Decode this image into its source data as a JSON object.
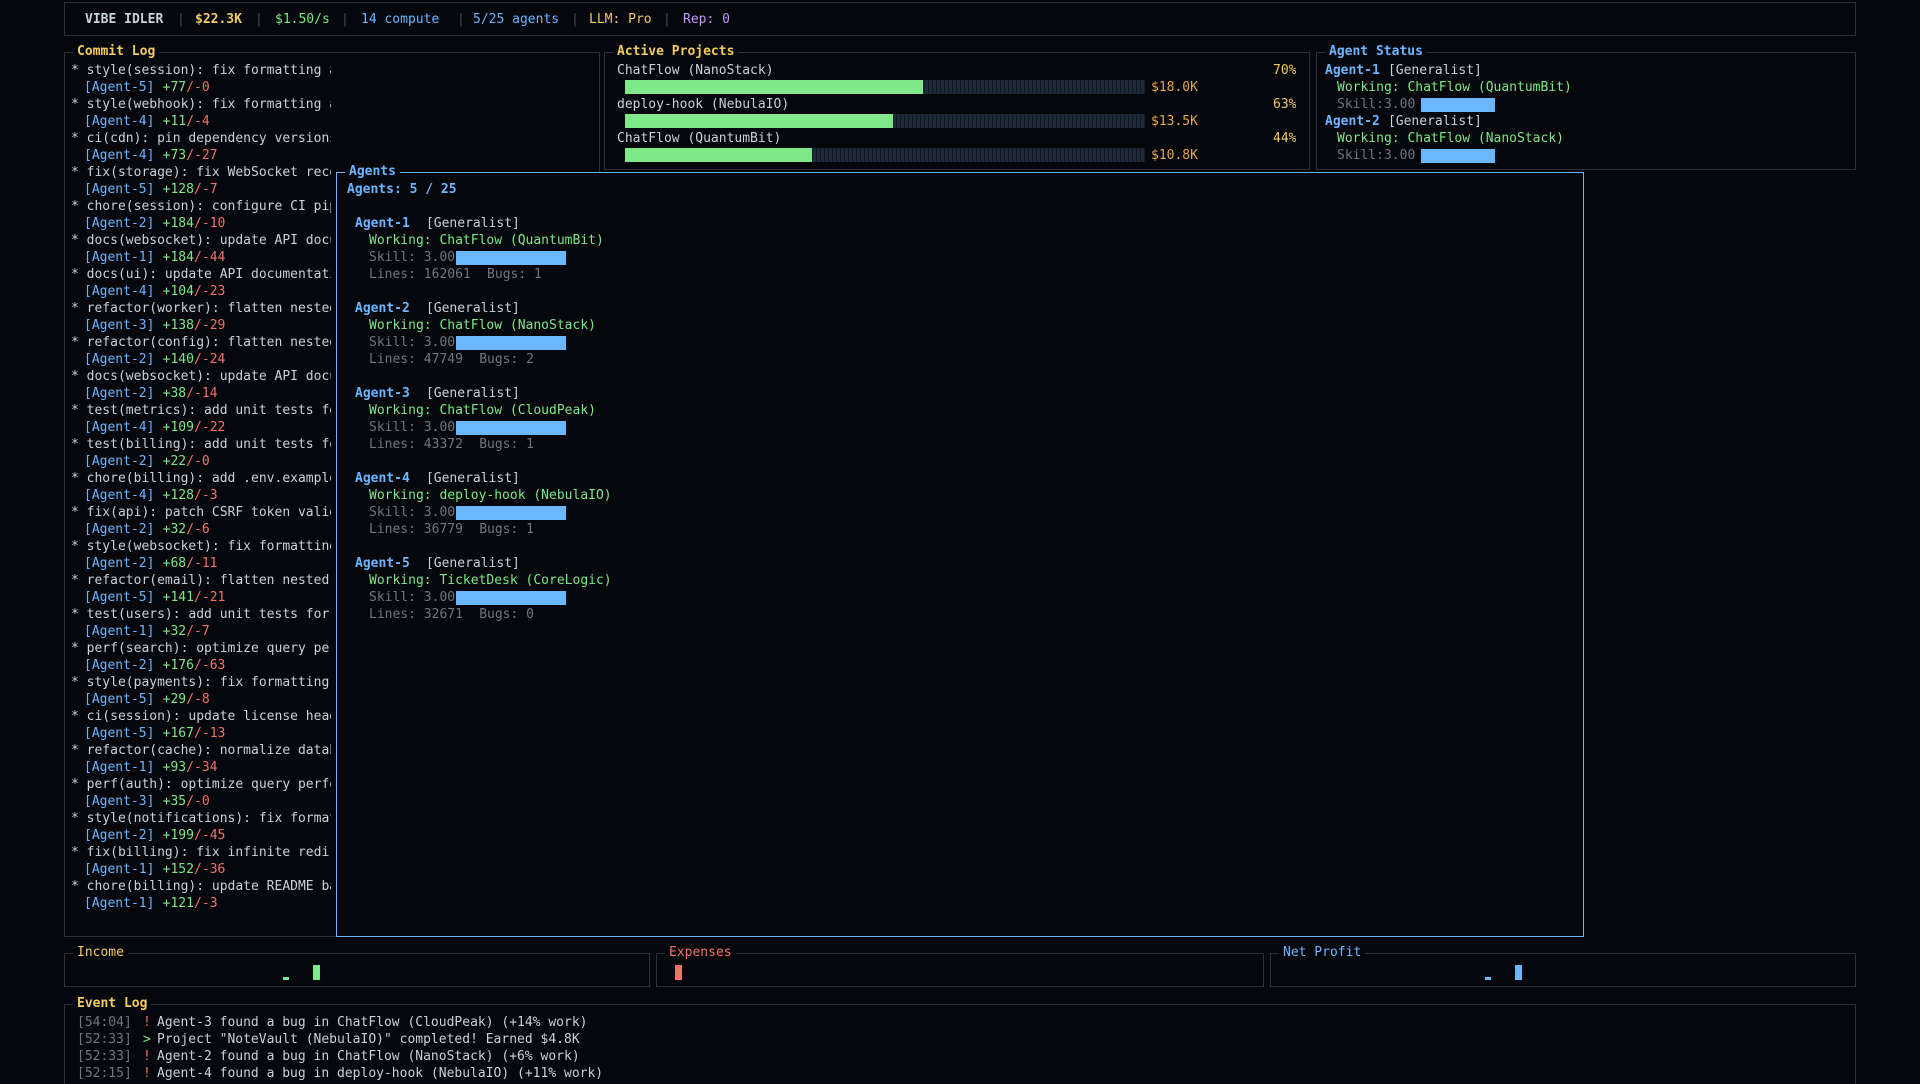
{
  "header": {
    "app": "VIBE IDLER",
    "money": "$22.3K",
    "rate": "$1.50/s",
    "compute": "14 compute",
    "agents": "5/25 agents",
    "llm": "LLM: Pro",
    "rep": "Rep: 0",
    "separator": "|"
  },
  "commit_log": {
    "title": "Commit Log",
    "entries": [
      {
        "msg": "* style(session): fix formatting and lint issues",
        "agent": "[Agent-5]",
        "add": "+77",
        "del": "/-0"
      },
      {
        "msg": "* style(webhook): fix formatting and lint issues",
        "agent": "[Agent-4]",
        "add": "+11",
        "del": "/-4"
      },
      {
        "msg": "* ci(cdn): pin dependency versions",
        "agent": "[Agent-4]",
        "add": "+73",
        "del": "/-27"
      },
      {
        "msg": "* fix(storage): fix WebSocket reconn",
        "agent": "[Agent-5]",
        "add": "+128",
        "del": "/-7"
      },
      {
        "msg": "* chore(session): configure CI pipel",
        "agent": "[Agent-2]",
        "add": "+184",
        "del": "/-10"
      },
      {
        "msg": "* docs(websocket): update API docume",
        "agent": "[Agent-1]",
        "add": "+184",
        "del": "/-44"
      },
      {
        "msg": "* docs(ui): update API documentation",
        "agent": "[Agent-4]",
        "add": "+104",
        "del": "/-23"
      },
      {
        "msg": "* refactor(worker): flatten nested c",
        "agent": "[Agent-3]",
        "add": "+138",
        "del": "/-29"
      },
      {
        "msg": "* refactor(config): flatten nested c",
        "agent": "[Agent-2]",
        "add": "+140",
        "del": "/-24"
      },
      {
        "msg": "* docs(websocket): update API docume",
        "agent": "[Agent-2]",
        "add": "+38",
        "del": "/-14"
      },
      {
        "msg": "* test(metrics): add unit tests for",
        "agent": "[Agent-4]",
        "add": "+109",
        "del": "/-22"
      },
      {
        "msg": "* test(billing): add unit tests for",
        "agent": "[Agent-2]",
        "add": "+22",
        "del": "/-0"
      },
      {
        "msg": "* chore(billing): add .env.example",
        "agent": "[Agent-4]",
        "add": "+128",
        "del": "/-3"
      },
      {
        "msg": "* fix(api): patch CSRF token validat",
        "agent": "[Agent-2]",
        "add": "+32",
        "del": "/-6"
      },
      {
        "msg": "* style(websocket): fix formatting a",
        "agent": "[Agent-2]",
        "add": "+68",
        "del": "/-11"
      },
      {
        "msg": "* refactor(email): flatten nested ca",
        "agent": "[Agent-5]",
        "add": "+141",
        "del": "/-21"
      },
      {
        "msg": "* test(users): add unit tests for mo",
        "agent": "[Agent-1]",
        "add": "+32",
        "del": "/-7"
      },
      {
        "msg": "* perf(search): optimize query perfo",
        "agent": "[Agent-2]",
        "add": "+176",
        "del": "/-63"
      },
      {
        "msg": "* style(payments): fix formatting an",
        "agent": "[Agent-5]",
        "add": "+29",
        "del": "/-8"
      },
      {
        "msg": "* ci(session): update license header",
        "agent": "[Agent-5]",
        "add": "+167",
        "del": "/-13"
      },
      {
        "msg": "* refactor(cache): normalize databas",
        "agent": "[Agent-1]",
        "add": "+93",
        "del": "/-34"
      },
      {
        "msg": "* perf(auth): optimize query perform",
        "agent": "[Agent-3]",
        "add": "+35",
        "del": "/-0"
      },
      {
        "msg": "* style(notifications): fix formatti",
        "agent": "[Agent-2]",
        "add": "+199",
        "del": "/-45"
      },
      {
        "msg": "* fix(billing): fix infinite redirec",
        "agent": "[Agent-1]",
        "add": "+152",
        "del": "/-36"
      },
      {
        "msg": "* chore(billing): update README badg",
        "agent": "[Agent-1]",
        "add": "+121",
        "del": "/-3"
      }
    ]
  },
  "projects": {
    "title": "Active Projects",
    "items": [
      {
        "name": "ChatFlow (NanoStack)",
        "percent": "70%",
        "progress": 0.7,
        "value": "$18.0K"
      },
      {
        "name": "deploy-hook (NebulaIO)",
        "percent": "63%",
        "progress": 0.63,
        "value": "$13.5K"
      },
      {
        "name": "ChatFlow (QuantumBit)",
        "percent": "44%",
        "progress": 0.44,
        "value": "$10.8K"
      }
    ]
  },
  "agent_status": {
    "title": "Agent Status",
    "items": [
      {
        "name": "Agent-1",
        "role": "[Generalist]",
        "working": "Working: ChatFlow (QuantumBit)",
        "skill": "Skill:3.00",
        "level": 1.0
      },
      {
        "name": "Agent-2",
        "role": "[Generalist]",
        "working": "Working: ChatFlow (NanoStack)",
        "skill": "Skill:3.00",
        "level": 1.0
      }
    ]
  },
  "agents_modal": {
    "title": "Agents",
    "count": "Agents: 5 / 25",
    "items": [
      {
        "name": "Agent-1",
        "role": "[Generalist]",
        "working": "Working: ChatFlow (QuantumBit)",
        "skill": "Skill: 3.00",
        "level": 1.0,
        "lines": "Lines: 162061",
        "bugs": "Bugs: 1"
      },
      {
        "name": "Agent-2",
        "role": "[Generalist]",
        "working": "Working: ChatFlow (NanoStack)",
        "skill": "Skill: 3.00",
        "level": 1.0,
        "lines": "Lines: 47749",
        "bugs": "Bugs: 2"
      },
      {
        "name": "Agent-3",
        "role": "[Generalist]",
        "working": "Working: ChatFlow (CloudPeak)",
        "skill": "Skill: 3.00",
        "level": 1.0,
        "lines": "Lines: 43372",
        "bugs": "Bugs: 1"
      },
      {
        "name": "Agent-4",
        "role": "[Generalist]",
        "working": "Working: deploy-hook (NebulaIO)",
        "skill": "Skill: 3.00",
        "level": 1.0,
        "lines": "Lines: 36779",
        "bugs": "Bugs: 1"
      },
      {
        "name": "Agent-5",
        "role": "[Generalist]",
        "working": "Working: TicketDesk (CoreLogic)",
        "skill": "Skill: 3.00",
        "level": 1.0,
        "lines": "Lines: 32671",
        "bugs": "Bugs: 0"
      }
    ]
  },
  "charts": {
    "income": {
      "title": "Income"
    },
    "expenses": {
      "title": "Expenses"
    },
    "net_profit": {
      "title": "Net Profit"
    }
  },
  "event_log": {
    "title": "Event Log",
    "entries": [
      {
        "time": "[54:04]",
        "marker": "!",
        "text": "Agent-3 found a bug in ChatFlow (CloudPeak) (+14% work)"
      },
      {
        "time": "[52:33]",
        "marker": ">",
        "text": "Project \"NoteVault (NebulaIO)\" completed! Earned $4.8K"
      },
      {
        "time": "[52:33]",
        "marker": "!",
        "text": "Agent-2 found a bug in ChatFlow (NanoStack) (+6% work)"
      },
      {
        "time": "[52:15]",
        "marker": "!",
        "text": "Agent-4 found a bug in deploy-hook (NebulaIO) (+11% work)"
      }
    ]
  },
  "colors": {
    "accent_blue": "#6cb6ff",
    "green": "#7ee787",
    "red": "#f47067",
    "yellow": "#f2cc60",
    "purple": "#c297ff",
    "border": "#2a2f3a"
  }
}
